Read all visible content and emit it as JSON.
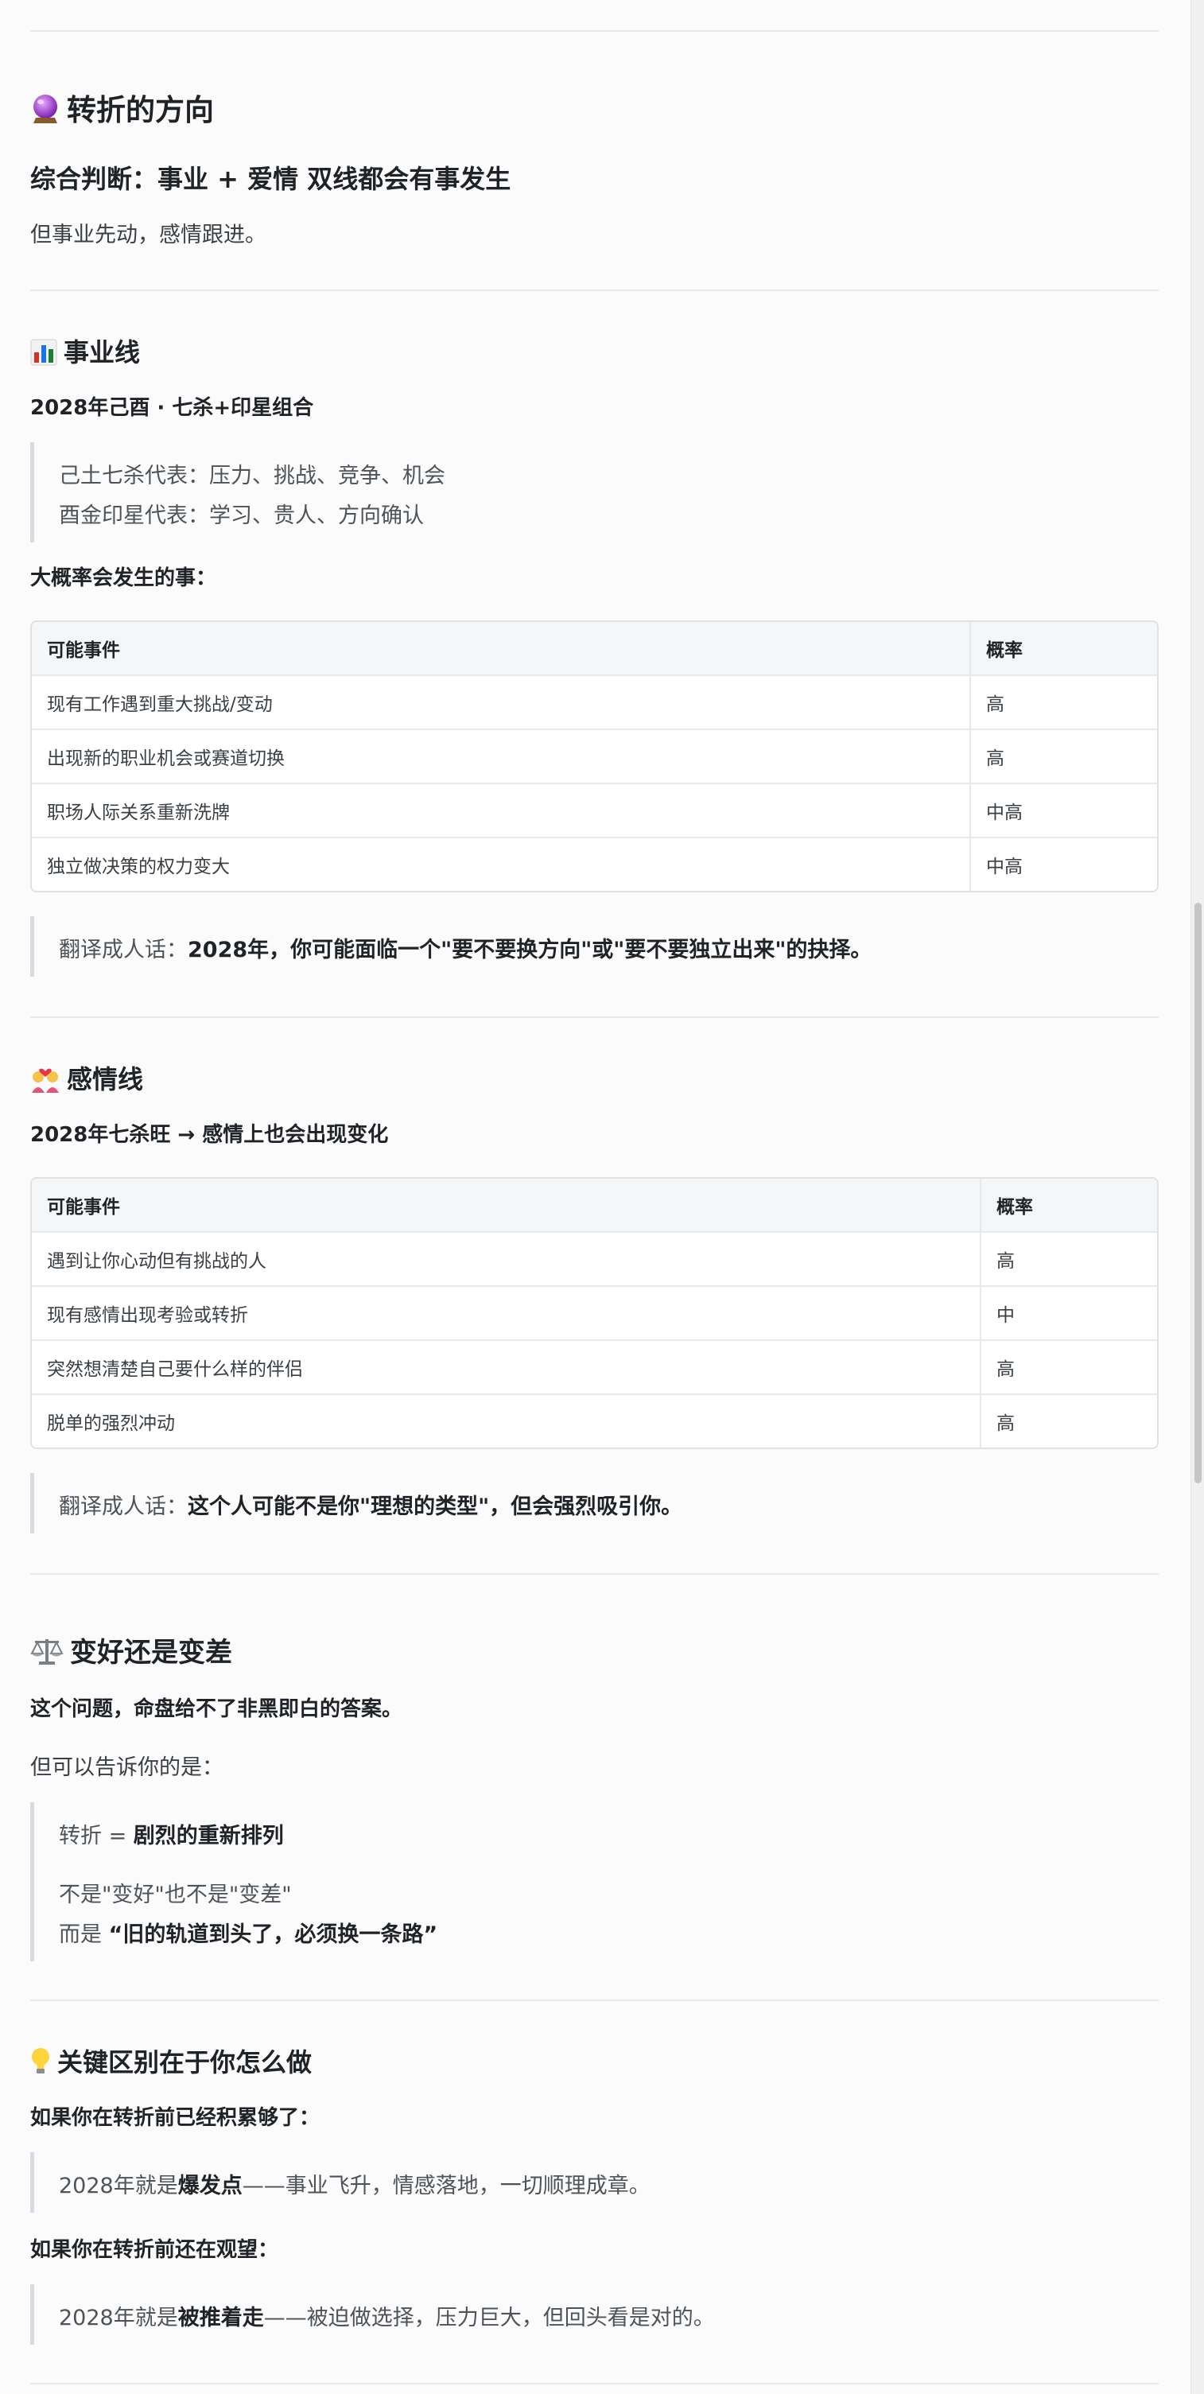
{
  "turn": {
    "heading": "转折的方向",
    "icon": "crystal-ball",
    "subheading": "综合判断：事业 + 爱情 双线都会有事发生",
    "text": "但事业先动，感情跟进。"
  },
  "career": {
    "heading": "事业线",
    "icon": "bar-chart",
    "subtitle": "2028年己酉 · 七杀+印星组合",
    "quote": [
      "己土七杀代表：压力、挑战、竞争、机会",
      "酉金印星代表：学习、贵人、方向确认"
    ],
    "likely_label": "大概率会发生的事：",
    "table": {
      "headers": [
        "可能事件",
        "概率"
      ],
      "rows": [
        [
          "现有工作遇到重大挑战/变动",
          "高"
        ],
        [
          "出现新的职业机会或赛道切换",
          "高"
        ],
        [
          "职场人际关系重新洗牌",
          "中高"
        ],
        [
          "独立做决策的权力变大",
          "中高"
        ]
      ]
    },
    "translate_prefix": "翻译成人话：",
    "translate_bold": "2028年，你可能面临一个\"要不要换方向\"或\"要不要独立出来\"的抉择。"
  },
  "love": {
    "heading": "感情线",
    "icon": "couple-heart",
    "subtitle": "2028年七杀旺 → 感情上也会出现变化",
    "table": {
      "headers": [
        "可能事件",
        "概率"
      ],
      "rows": [
        [
          "遇到让你心动但有挑战的人",
          "高"
        ],
        [
          "现有感情出现考验或转折",
          "中"
        ],
        [
          "突然想清楚自己要什么样的伴侣",
          "高"
        ],
        [
          "脱单的强烈冲动",
          "高"
        ]
      ]
    },
    "translate_prefix": "翻译成人话：",
    "translate_bold": "这个人可能不是你\"理想的类型\"，但会强烈吸引你。"
  },
  "better": {
    "heading": "变好还是变差",
    "icon": "balance-scale",
    "bold": "这个问题，命盘给不了非黑即白的答案。",
    "text": "但可以告诉你的是：",
    "quote_l1_prefix": "转折 = ",
    "quote_l1_bold": "剧烈的重新排列",
    "quote_l2": "不是\"变好\"也不是\"变差\"",
    "quote_l3_prefix": "而是 ",
    "quote_l3_bold": "“旧的轨道到头了，必须换一条路”"
  },
  "key": {
    "heading": "关键区别在于你怎么做",
    "icon": "light-bulb",
    "case1_label": "如果你在转折前已经积累够了：",
    "case1_prefix": "2028年就是",
    "case1_bold": "爆发点",
    "case1_suffix": "——事业飞升，情感落地，一切顺理成章。",
    "case2_label": "如果你在转折前还在观望：",
    "case2_prefix": "2028年就是",
    "case2_bold": "被推着走",
    "case2_suffix": "——被迫做选择，压力巨大，但回头看是对的。"
  }
}
